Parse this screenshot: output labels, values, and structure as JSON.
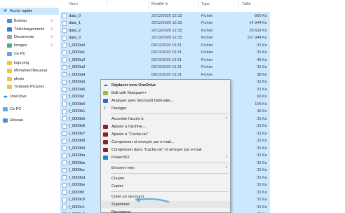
{
  "nav": {
    "items": [
      {
        "label": "Accès rapide",
        "icon": "star-icon",
        "pinned": false,
        "selected": true
      },
      {
        "label": "Bureau",
        "icon": "desktop-folder-icon",
        "pinned": true
      },
      {
        "label": "Téléchargements",
        "icon": "download-folder-icon",
        "pinned": true
      },
      {
        "label": "Documents",
        "icon": "documents-folder-icon",
        "pinned": true
      },
      {
        "label": "Images",
        "icon": "images-folder-icon",
        "pinned": true
      },
      {
        "label": "Ce PC",
        "icon": "pc-icon",
        "pinned": false
      },
      {
        "label": "logo png",
        "icon": "folder-icon",
        "pinned": false
      },
      {
        "label": "Mohamed Bouaoui",
        "icon": "folder-icon",
        "pinned": false
      },
      {
        "label": "photo",
        "icon": "folder-icon",
        "pinned": false
      },
      {
        "label": "Trobweb Pictures",
        "icon": "folder-icon",
        "pinned": false
      },
      {
        "label": "OneDrive",
        "icon": "cloud-icon",
        "pinned": false
      },
      {
        "label": "Ce PC",
        "icon": "pc-icon",
        "pinned": false
      },
      {
        "label": "Réseau",
        "icon": "network-icon",
        "pinned": false
      }
    ],
    "pin_glyph": "📌"
  },
  "columns": {
    "name": "Nom",
    "modified": "Modifié le",
    "type": "Type",
    "size": "Taille"
  },
  "files": [
    {
      "name": "data_0",
      "date": "22/12/2020 12:33",
      "type": "Fichier",
      "size": "800 Ko"
    },
    {
      "name": "data_1",
      "date": "22/12/2020 12:33",
      "type": "Fichier",
      "size": "14 344 Ko"
    },
    {
      "name": "data_2",
      "date": "22/12/2020 12:33",
      "type": "Fichier",
      "size": "26 632 Ko"
    },
    {
      "name": "data_3",
      "date": "22/12/2020 12:33",
      "type": "Fichier",
      "size": "167 944 Ko"
    },
    {
      "name": "f_0000a0",
      "date": "09/11/2020 15:31",
      "type": "Fichier",
      "size": "31 Ko"
    },
    {
      "name": "f_0000a1",
      "date": "09/11/2020 15:31",
      "type": "Fichier",
      "size": "31 Ko"
    },
    {
      "name": "f_0000a2",
      "date": "09/11/2020 15:31",
      "type": "Fichier",
      "size": "45 Ko"
    },
    {
      "name": "f_0000a3",
      "date": "09/11/2020 15:31",
      "type": "Fichier",
      "size": "31 Ko"
    },
    {
      "name": "f_0000a4",
      "date": "09/11/2020 15:31",
      "type": "Fichier",
      "size": "38 Ko"
    },
    {
      "name": "f_0000a5",
      "date": "",
      "type": "",
      "size": "31 Ko"
    },
    {
      "name": "f_0000a6",
      "date": "",
      "type": "",
      "size": "31 Ko"
    },
    {
      "name": "f_0000af",
      "date": "",
      "type": "",
      "size": "69 Ko"
    },
    {
      "name": "f_0000b0",
      "date": "",
      "type": "",
      "size": "105 Ko"
    },
    {
      "name": "f_0000b1",
      "date": "",
      "type": "",
      "size": "46 Ko"
    },
    {
      "name": "f_0000b5",
      "date": "",
      "type": "",
      "size": "31 Ko"
    },
    {
      "name": "f_0000b6",
      "date": "",
      "type": "",
      "size": "31 Ko"
    },
    {
      "name": "f_0000b7",
      "date": "",
      "type": "",
      "size": "31 Ko"
    },
    {
      "name": "f_0000b8",
      "date": "",
      "type": "",
      "size": "31 Ko"
    },
    {
      "name": "f_0000b9",
      "date": "",
      "type": "",
      "size": "31 Ko"
    },
    {
      "name": "f_0000ba",
      "date": "",
      "type": "",
      "size": "31 Ko"
    },
    {
      "name": "f_0000bb",
      "date": "",
      "type": "",
      "size": "31 Ko"
    },
    {
      "name": "f_0000bc",
      "date": "",
      "type": "",
      "size": "31 Ko"
    },
    {
      "name": "f_0000bd",
      "date": "",
      "type": "",
      "size": "31 Ko"
    },
    {
      "name": "f_0000be",
      "date": "",
      "type": "",
      "size": "31 Ko"
    },
    {
      "name": "f_0000bf",
      "date": "",
      "type": "",
      "size": "31 Ko"
    },
    {
      "name": "f_0000c0",
      "date": "",
      "type": "",
      "size": "31 Ko"
    },
    {
      "name": "f_0000c1",
      "date": "",
      "type": "",
      "size": "31 Ko"
    },
    {
      "name": "f_0000c2",
      "date": "",
      "type": "",
      "size": "31 Ko"
    }
  ],
  "context_menu": {
    "items": [
      {
        "label": "Déplacer vers OneDrive",
        "icon": "onedrive-icon",
        "bold": true,
        "submenu": false
      },
      {
        "label": "Edit with Notepad++",
        "icon": "notepadpp-icon",
        "bold": false,
        "submenu": false
      },
      {
        "label": "Analyser avec Microsoft Defender...",
        "icon": "defender-shield-icon",
        "bold": false,
        "submenu": false
      },
      {
        "label": "Partager",
        "icon": "share-icon",
        "bold": false,
        "submenu": false
      },
      {
        "label": "Accorder l'accès à",
        "icon": "",
        "bold": false,
        "submenu": true,
        "sep_before": true
      },
      {
        "label": "Ajouter à l'archive...",
        "icon": "winrar-icon",
        "bold": false,
        "submenu": false
      },
      {
        "label": "Ajouter à \"Cache.rar\"",
        "icon": "winrar-icon",
        "bold": false,
        "submenu": false
      },
      {
        "label": "Compresser et envoyer par e-mail...",
        "icon": "winrar-icon",
        "bold": false,
        "submenu": false
      },
      {
        "label": "Compresser dans \"Cache.rar\" et envoyer par e-mail",
        "icon": "winrar-icon",
        "bold": false,
        "submenu": false
      },
      {
        "label": "PowerISO",
        "icon": "poweriso-icon",
        "bold": false,
        "submenu": true
      },
      {
        "label": "Envoyer vers",
        "icon": "",
        "bold": false,
        "submenu": true,
        "sep_before": true
      },
      {
        "label": "Couper",
        "icon": "",
        "bold": false,
        "submenu": false,
        "sep_before": true
      },
      {
        "label": "Copier",
        "icon": "",
        "bold": false,
        "submenu": false
      },
      {
        "label": "Créer un raccourci",
        "icon": "",
        "bold": false,
        "submenu": false,
        "sep_before": true
      },
      {
        "label": "Supprimer",
        "icon": "",
        "bold": false,
        "submenu": false,
        "highlighted": true
      },
      {
        "label": "Renommer",
        "icon": "",
        "bold": false,
        "submenu": false
      }
    ],
    "submenu_arrow": "›"
  },
  "annotation": {
    "color": "#5fb8d6",
    "target": "Supprimer"
  },
  "colors": {
    "selection": "#cce8ff",
    "menu_bg": "#f2f2f2",
    "header_text": "#4b5a6b"
  }
}
